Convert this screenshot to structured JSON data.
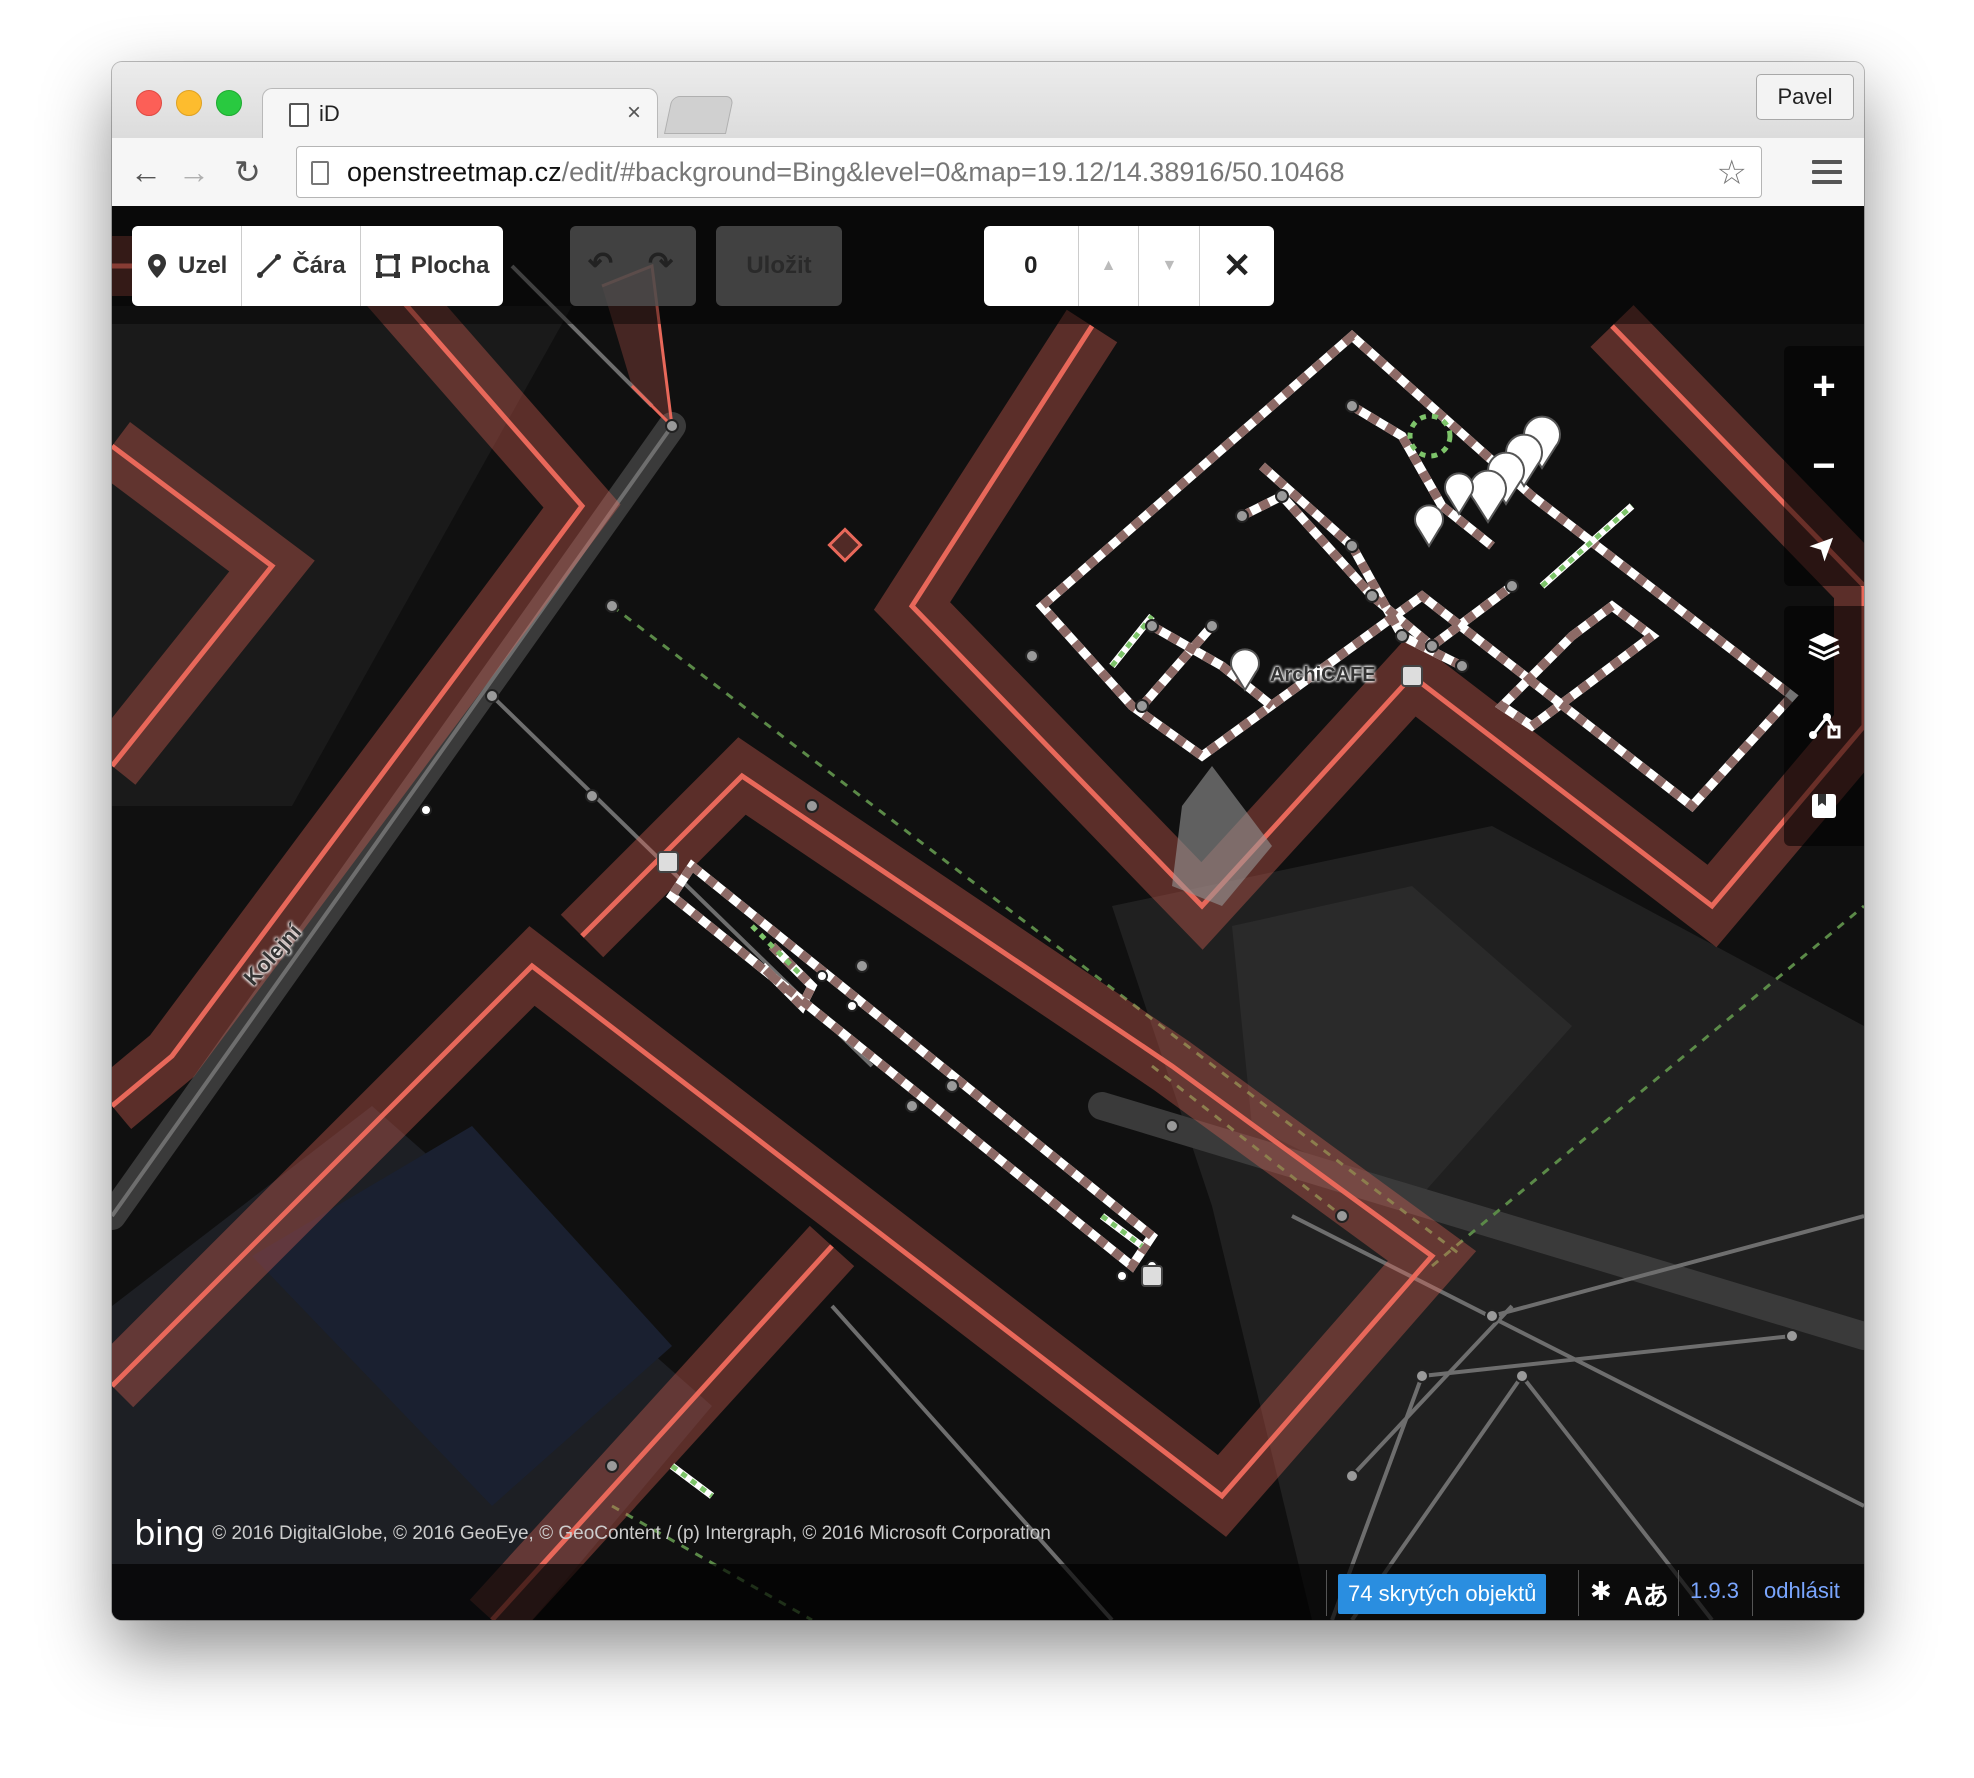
{
  "browser": {
    "tab_title": "iD",
    "tab_close": "×",
    "user": "Pavel",
    "url_host": "openstreetmap.cz",
    "url_path": "/edit/#background=Bing&level=0&map=19.12/14.38916/50.10468",
    "back": "←",
    "forward": "→",
    "reload": "↻",
    "star": "☆"
  },
  "editor": {
    "modes": [
      {
        "label": "Uzel",
        "icon": "point-icon"
      },
      {
        "label": "Čára",
        "icon": "line-icon"
      },
      {
        "label": "Plocha",
        "icon": "area-icon"
      }
    ],
    "undo_icon": "↶",
    "redo_icon": "↷",
    "save_label": "Uložit",
    "level": {
      "value": "0",
      "up": "▲",
      "down": "▼",
      "close": "✕"
    },
    "zoom_in": "+",
    "zoom_out": "−",
    "geolocate": "➤",
    "map_labels": {
      "street": "Kolejní",
      "poi": "ArchiCAFE"
    },
    "attribution": {
      "logo": "bing",
      "text": "© 2016 DigitalGlobe, © 2016 GeoEye, © GeoContent / (p) Intergraph, © 2016 Microsoft Corporation"
    },
    "footer": {
      "hidden_features": "74 skrytých objektů",
      "bug_icon": "✱",
      "lang_icon": "Aあ",
      "version": "1.9.3",
      "logout": "odhlásit"
    }
  },
  "colors": {
    "building_outline": "#e8685a",
    "building_fill": "#7a3a34",
    "indoor_way": "#a88a86",
    "footway": "#7dc46a",
    "accent": "#2a8ee0"
  }
}
